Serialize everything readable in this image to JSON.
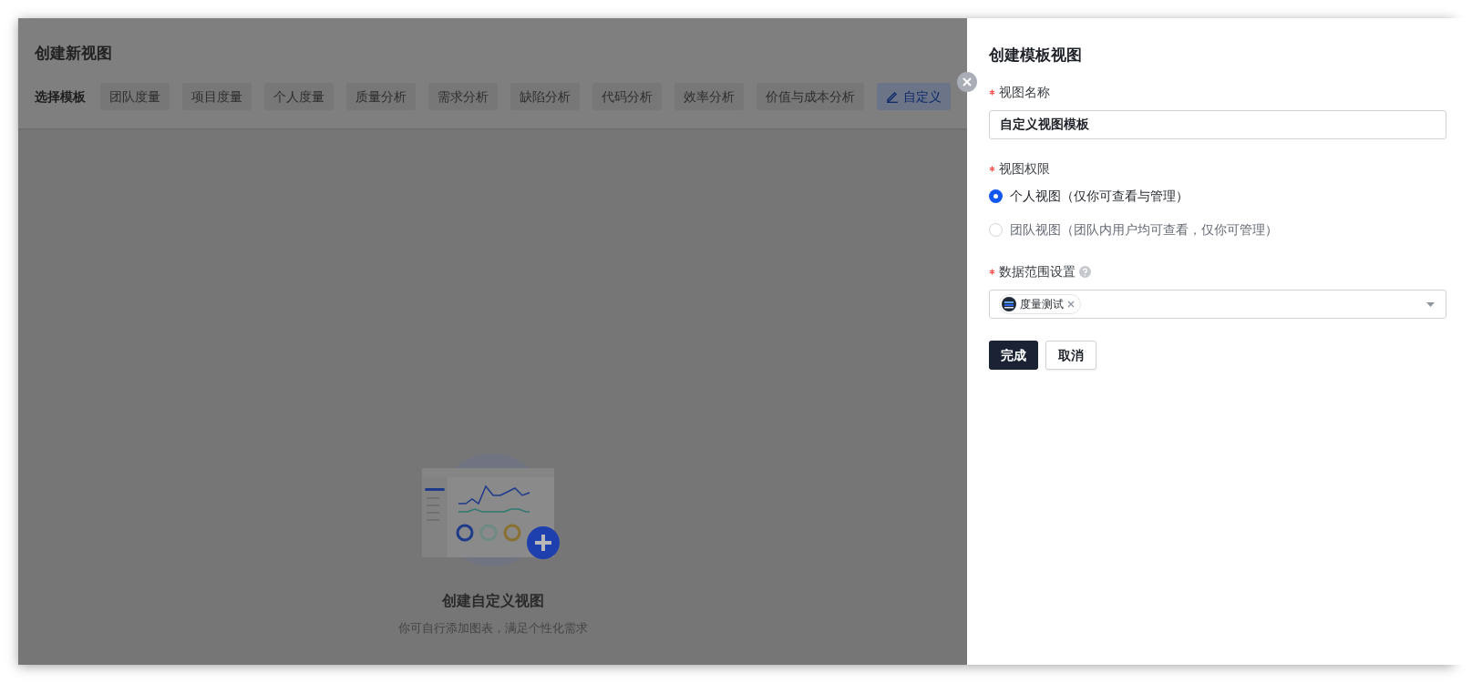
{
  "page": {
    "title": "创建新视图",
    "template_label": "选择模板",
    "templates": [
      {
        "label": "团队度量",
        "selected": false,
        "kind": "preset"
      },
      {
        "label": "项目度量",
        "selected": false,
        "kind": "preset"
      },
      {
        "label": "个人度量",
        "selected": false,
        "kind": "preset"
      },
      {
        "label": "质量分析",
        "selected": false,
        "kind": "preset"
      },
      {
        "label": "需求分析",
        "selected": false,
        "kind": "preset"
      },
      {
        "label": "缺陷分析",
        "selected": false,
        "kind": "preset"
      },
      {
        "label": "代码分析",
        "selected": false,
        "kind": "preset"
      },
      {
        "label": "效率分析",
        "selected": false,
        "kind": "preset"
      },
      {
        "label": "价值与成本分析",
        "selected": false,
        "kind": "preset"
      },
      {
        "label": "自定义",
        "selected": true,
        "kind": "custom"
      }
    ]
  },
  "empty_state": {
    "title": "创建自定义视图",
    "description": "你可自行添加图表，满足个性化需求"
  },
  "drawer": {
    "title": "创建模板视图",
    "name_field": {
      "label": "视图名称",
      "required": true,
      "value": "自定义视图模板"
    },
    "permission_field": {
      "label": "视图权限",
      "required": true,
      "options": [
        {
          "label": "个人视图（仅你可查看与管理）",
          "selected": true
        },
        {
          "label": "团队视图（团队内用户均可查看，仅你可管理）",
          "selected": false
        }
      ]
    },
    "scope_field": {
      "label": "数据范围设置",
      "required": true,
      "tags": [
        {
          "label": "度量测试"
        }
      ]
    },
    "buttons": [
      {
        "label": "完成",
        "kind": "primary"
      },
      {
        "label": "取消",
        "kind": "secondary"
      }
    ]
  }
}
